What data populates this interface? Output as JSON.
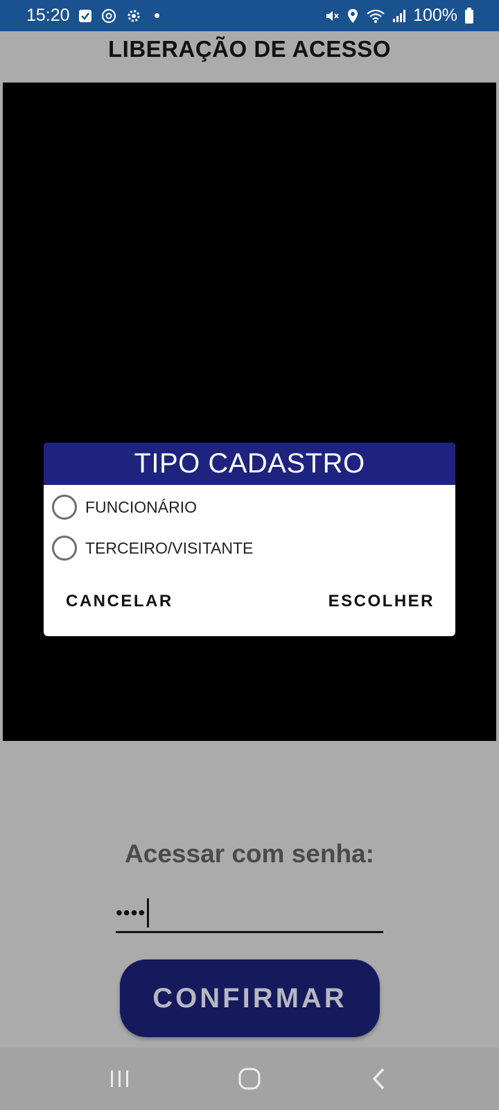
{
  "status_bar": {
    "time": "15:20",
    "battery": "100%",
    "icons": [
      "check-box-icon",
      "sync-icon",
      "gear-icon",
      "dot-icon",
      "mute-icon",
      "location-icon",
      "wifi-icon",
      "signal-icon",
      "battery-icon"
    ]
  },
  "header": {
    "title": "LIBERAÇÃO DE ACESSO"
  },
  "dialog": {
    "title": "TIPO CADASTRO",
    "options": [
      {
        "label": "FUNCIONÁRIO",
        "selected": false
      },
      {
        "label": "TERCEIRO/VISITANTE",
        "selected": false
      }
    ],
    "cancel_label": "CANCELAR",
    "confirm_label": "ESCOLHER"
  },
  "password": {
    "label": "Acessar com senha:",
    "value_masked": "••••"
  },
  "confirm_button": {
    "label": "CONFIRMAR"
  },
  "nav_bar": {
    "icons": [
      "recent-apps-icon",
      "home-icon",
      "back-icon"
    ]
  },
  "colors": {
    "status_bar": "#1a5290",
    "dialog_header": "#1e237f",
    "confirm_button": "#141a5c",
    "background": "#ababab"
  }
}
